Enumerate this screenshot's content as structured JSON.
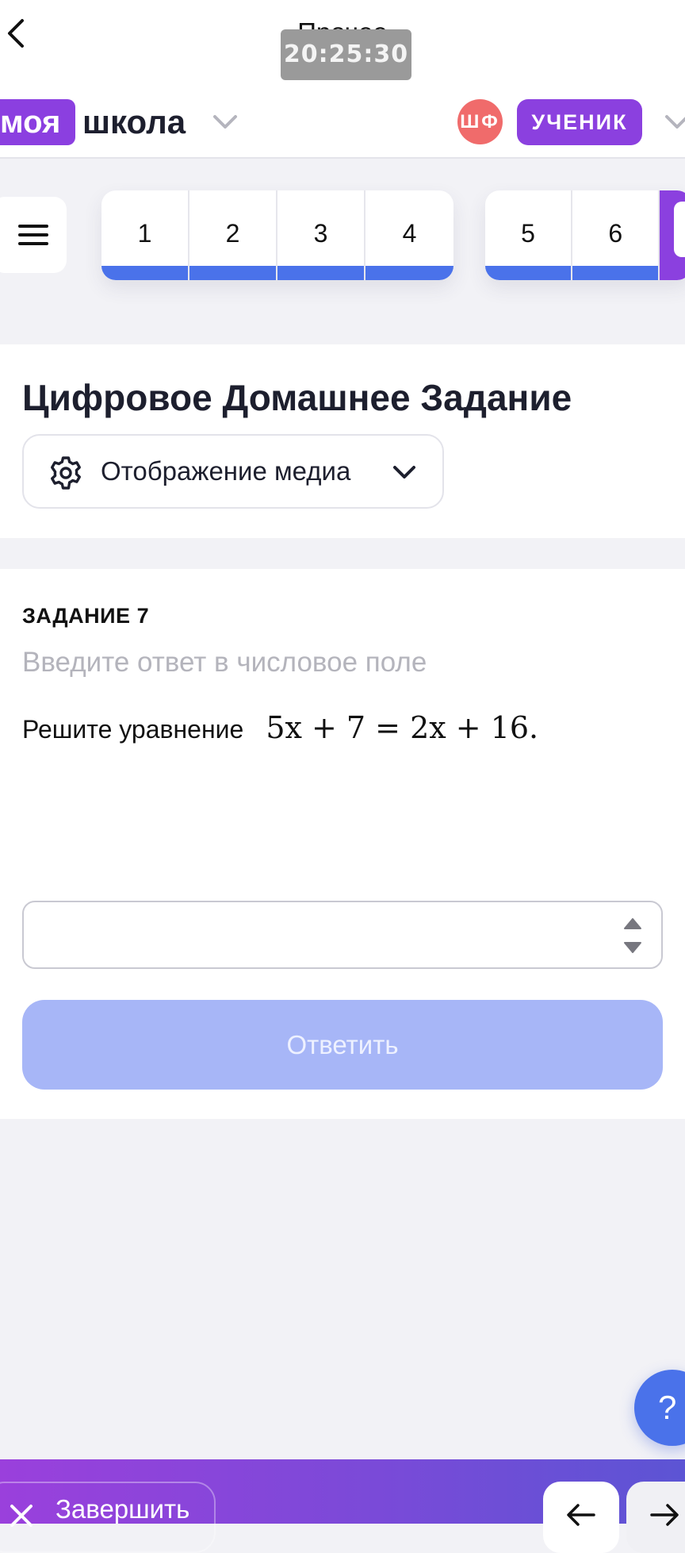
{
  "topnav": {
    "title": "Прочее",
    "time": "20:25:30",
    "back_icon": "chevron-left-icon"
  },
  "header": {
    "logo_badge": "моя",
    "logo_text": "школа",
    "avatar_initials": "ШФ",
    "role": "УЧЕНИК",
    "chevron_icon": "chevron-down-icon",
    "colors": {
      "brand": "#8b40df",
      "avatar": "#f06b6b"
    }
  },
  "tabs": {
    "menu_icon": "hamburger-icon",
    "group1": [
      "1",
      "2",
      "3",
      "4"
    ],
    "group2": [
      "5",
      "6"
    ],
    "progress_color": "#4a72ea"
  },
  "homework": {
    "title": "Цифровое Домашнее Задание",
    "media_button": "Отображение медиа",
    "media_icon": "gear-icon"
  },
  "task": {
    "label": "ЗАДАНИЕ 7",
    "hint": "Введите ответ в числовое поле",
    "question": "Решите уравнение",
    "equation": "5x + 7 = 2x + 16.",
    "answer_value": "",
    "submit_label": "Ответить",
    "submit_color": "#a7b6f7"
  },
  "help": {
    "label": "?"
  },
  "bottom": {
    "finish_label": "Завершить",
    "prev_icon": "arrow-left-icon",
    "next_icon": "arrow-right-icon"
  }
}
